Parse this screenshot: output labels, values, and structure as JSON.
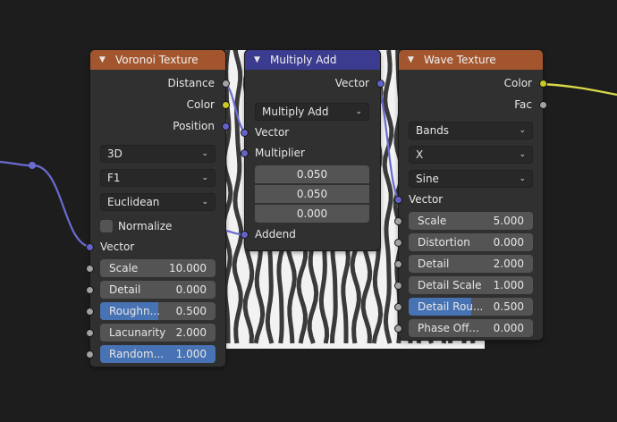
{
  "colors": {
    "background": "#1d1d1d",
    "node_body": "#303030",
    "texture_header": "#a3562e",
    "converter_header": "#3b3b8f",
    "vector_socket": "#6363c7",
    "color_socket": "#c7c729",
    "float_socket": "#a1a1a1",
    "slider_fill": "#4772b3",
    "link_vector": "#6b6bd1",
    "link_color": "#d8d84a"
  },
  "icons": {
    "collapse": "chevron-down-icon",
    "dropdown": "chevron-down-icon",
    "checkbox": "checkbox-icon"
  },
  "voronoi": {
    "title": "Voronoi Texture",
    "outputs": [
      "Distance",
      "Color",
      "Position"
    ],
    "dimensions": "3D",
    "feature": "F1",
    "distance_metric": "Euclidean",
    "normalize_label": "Normalize",
    "input_vector": "Vector",
    "fields": [
      {
        "label": "Scale",
        "value": "10.000",
        "fill": 0
      },
      {
        "label": "Detail",
        "value": "0.000",
        "fill": 0
      },
      {
        "label": "Roughn...",
        "value": "0.500",
        "fill": 0.5
      },
      {
        "label": "Lacunarity",
        "value": "2.000",
        "fill": 0
      },
      {
        "label": "Random...",
        "value": "1.000",
        "fill": 1
      }
    ]
  },
  "multiply_add": {
    "title": "Multiply Add",
    "output": "Vector",
    "operation": "Multiply Add",
    "input_vector": "Vector",
    "multiplier_label": "Multiplier",
    "multiplier_values": [
      "0.050",
      "0.050",
      "0.000"
    ],
    "addend_label": "Addend"
  },
  "wave": {
    "title": "Wave Texture",
    "outputs": [
      "Color",
      "Fac"
    ],
    "wave_type": "Bands",
    "direction": "X",
    "profile": "Sine",
    "input_vector": "Vector",
    "fields": [
      {
        "label": "Scale",
        "value": "5.000",
        "fill": 0
      },
      {
        "label": "Distortion",
        "value": "0.000",
        "fill": 0
      },
      {
        "label": "Detail",
        "value": "2.000",
        "fill": 0
      },
      {
        "label": "Detail Scale",
        "value": "1.000",
        "fill": 0
      },
      {
        "label": "Detail Rou...",
        "value": "0.500",
        "fill": 0.5
      },
      {
        "label": "Phase Off...",
        "value": "0.000",
        "fill": 0
      }
    ]
  }
}
